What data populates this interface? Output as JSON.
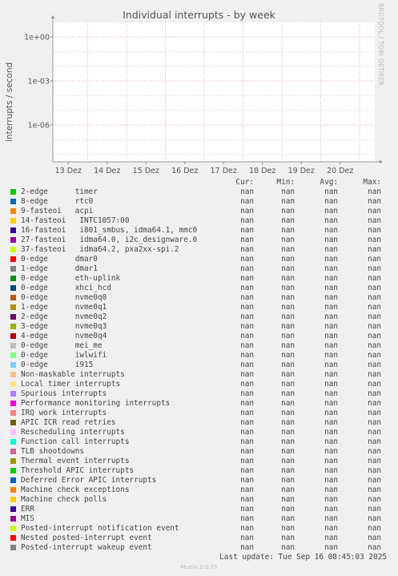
{
  "title": "Individual interrupts - by week",
  "watermark": "RRDTOOL / TOBI OETIKER",
  "last_update": "Last update: Tue Sep 16 08:45:03 2025",
  "munin_version": "Munin 2.0.73",
  "legend_header": {
    "cur": "Cur:",
    "min": "Min:",
    "avg": "Avg:",
    "max": "Max:"
  },
  "chart_data": {
    "type": "line",
    "title": "Individual interrupts - by week",
    "ylabel": "interrupts / second",
    "xlabel": "",
    "y_scale": "log",
    "y_ticks": [
      {
        "value": 1,
        "label": "1e+00"
      },
      {
        "value": 0.001,
        "label": "1e-03"
      },
      {
        "value": 1e-06,
        "label": "1e-06"
      }
    ],
    "x_ticks": [
      "13 Dez",
      "14 Dez",
      "15 Dez",
      "16 Dez",
      "17 Dez",
      "18 Dez",
      "19 Dez",
      "20 Dez"
    ],
    "grid": true,
    "legend_placement": "bottom",
    "series": [
      {
        "name": "2-edge      timer",
        "color": "#00cc00",
        "cur": "nan",
        "min": "nan",
        "avg": "nan",
        "max": "nan",
        "values": []
      },
      {
        "name": "8-edge      rtc0",
        "color": "#0066b3",
        "cur": "nan",
        "min": "nan",
        "avg": "nan",
        "max": "nan",
        "values": []
      },
      {
        "name": "9-fasteoi   acpi",
        "color": "#ff8000",
        "cur": "nan",
        "min": "nan",
        "avg": "nan",
        "max": "nan",
        "values": []
      },
      {
        "name": "14-fasteoi   INTC1057:00",
        "color": "#ffcc00",
        "cur": "nan",
        "min": "nan",
        "avg": "nan",
        "max": "nan",
        "values": []
      },
      {
        "name": "16-fasteoi   i801_smbus, idma64.1, mmc0",
        "color": "#330099",
        "cur": "nan",
        "min": "nan",
        "avg": "nan",
        "max": "nan",
        "values": []
      },
      {
        "name": "27-fasteoi   idma64.0, i2c_designware.0",
        "color": "#990099",
        "cur": "nan",
        "min": "nan",
        "avg": "nan",
        "max": "nan",
        "values": []
      },
      {
        "name": "37-fasteoi   idma64.2, pxa2xx-spi.2",
        "color": "#ccff00",
        "cur": "nan",
        "min": "nan",
        "avg": "nan",
        "max": "nan",
        "values": []
      },
      {
        "name": "0-edge      dmar0",
        "color": "#ff0000",
        "cur": "nan",
        "min": "nan",
        "avg": "nan",
        "max": "nan",
        "values": []
      },
      {
        "name": "1-edge      dmar1",
        "color": "#808080",
        "cur": "nan",
        "min": "nan",
        "avg": "nan",
        "max": "nan",
        "values": []
      },
      {
        "name": "0-edge      eth-uplink",
        "color": "#008f00",
        "cur": "nan",
        "min": "nan",
        "avg": "nan",
        "max": "nan",
        "values": []
      },
      {
        "name": "0-edge      xhci_hcd",
        "color": "#00487d",
        "cur": "nan",
        "min": "nan",
        "avg": "nan",
        "max": "nan",
        "values": []
      },
      {
        "name": "0-edge      nvme0q0",
        "color": "#b35a00",
        "cur": "nan",
        "min": "nan",
        "avg": "nan",
        "max": "nan",
        "values": []
      },
      {
        "name": "1-edge      nvme0q1",
        "color": "#b38f00",
        "cur": "nan",
        "min": "nan",
        "avg": "nan",
        "max": "nan",
        "values": []
      },
      {
        "name": "2-edge      nvme0q2",
        "color": "#6b006b",
        "cur": "nan",
        "min": "nan",
        "avg": "nan",
        "max": "nan",
        "values": []
      },
      {
        "name": "3-edge      nvme0q3",
        "color": "#8fb300",
        "cur": "nan",
        "min": "nan",
        "avg": "nan",
        "max": "nan",
        "values": []
      },
      {
        "name": "4-edge      nvme0q4",
        "color": "#b30000",
        "cur": "nan",
        "min": "nan",
        "avg": "nan",
        "max": "nan",
        "values": []
      },
      {
        "name": "0-edge      mei_me",
        "color": "#bebebe",
        "cur": "nan",
        "min": "nan",
        "avg": "nan",
        "max": "nan",
        "values": []
      },
      {
        "name": "0-edge      iwlwifi",
        "color": "#80ff80",
        "cur": "nan",
        "min": "nan",
        "avg": "nan",
        "max": "nan",
        "values": []
      },
      {
        "name": "0-edge      i915",
        "color": "#80c9ff",
        "cur": "nan",
        "min": "nan",
        "avg": "nan",
        "max": "nan",
        "values": []
      },
      {
        "name": "Non-maskable interrupts",
        "color": "#ffc080",
        "cur": "nan",
        "min": "nan",
        "avg": "nan",
        "max": "nan",
        "values": []
      },
      {
        "name": "Local timer interrupts",
        "color": "#ffe680",
        "cur": "nan",
        "min": "nan",
        "avg": "nan",
        "max": "nan",
        "values": []
      },
      {
        "name": "Spurious interrupts",
        "color": "#aa80ff",
        "cur": "nan",
        "min": "nan",
        "avg": "nan",
        "max": "nan",
        "values": []
      },
      {
        "name": "Performance monitoring interrupts",
        "color": "#ee00cc",
        "cur": "nan",
        "min": "nan",
        "avg": "nan",
        "max": "nan",
        "values": []
      },
      {
        "name": "IRQ work interrupts",
        "color": "#ff8080",
        "cur": "nan",
        "min": "nan",
        "avg": "nan",
        "max": "nan",
        "values": []
      },
      {
        "name": "APIC ICR read retries",
        "color": "#666600",
        "cur": "nan",
        "min": "nan",
        "avg": "nan",
        "max": "nan",
        "values": []
      },
      {
        "name": "Rescheduling interrupts",
        "color": "#ffbfff",
        "cur": "nan",
        "min": "nan",
        "avg": "nan",
        "max": "nan",
        "values": []
      },
      {
        "name": "Function call interrupts",
        "color": "#00ffcc",
        "cur": "nan",
        "min": "nan",
        "avg": "nan",
        "max": "nan",
        "values": []
      },
      {
        "name": "TLB shootdowns",
        "color": "#cc6699",
        "cur": "nan",
        "min": "nan",
        "avg": "nan",
        "max": "nan",
        "values": []
      },
      {
        "name": "Thermal event interrupts",
        "color": "#999900",
        "cur": "nan",
        "min": "nan",
        "avg": "nan",
        "max": "nan",
        "values": []
      },
      {
        "name": "Threshold APIC interrupts",
        "color": "#00cc00",
        "cur": "nan",
        "min": "nan",
        "avg": "nan",
        "max": "nan",
        "values": []
      },
      {
        "name": "Deferred Error APIC interrupts",
        "color": "#0066b3",
        "cur": "nan",
        "min": "nan",
        "avg": "nan",
        "max": "nan",
        "values": []
      },
      {
        "name": "Machine check exceptions",
        "color": "#ff8000",
        "cur": "nan",
        "min": "nan",
        "avg": "nan",
        "max": "nan",
        "values": []
      },
      {
        "name": "Machine check polls",
        "color": "#ffcc00",
        "cur": "nan",
        "min": "nan",
        "avg": "nan",
        "max": "nan",
        "values": []
      },
      {
        "name": "ERR",
        "color": "#330099",
        "cur": "nan",
        "min": "nan",
        "avg": "nan",
        "max": "nan",
        "values": []
      },
      {
        "name": "MIS",
        "color": "#990099",
        "cur": "nan",
        "min": "nan",
        "avg": "nan",
        "max": "nan",
        "values": []
      },
      {
        "name": "Posted-interrupt notification event",
        "color": "#ccff00",
        "cur": "nan",
        "min": "nan",
        "avg": "nan",
        "max": "nan",
        "values": []
      },
      {
        "name": "Nested posted-interrupt event",
        "color": "#ff0000",
        "cur": "nan",
        "min": "nan",
        "avg": "nan",
        "max": "nan",
        "values": []
      },
      {
        "name": "Posted-interrupt wakeup event",
        "color": "#808080",
        "cur": "nan",
        "min": "nan",
        "avg": "nan",
        "max": "nan",
        "values": []
      }
    ]
  }
}
